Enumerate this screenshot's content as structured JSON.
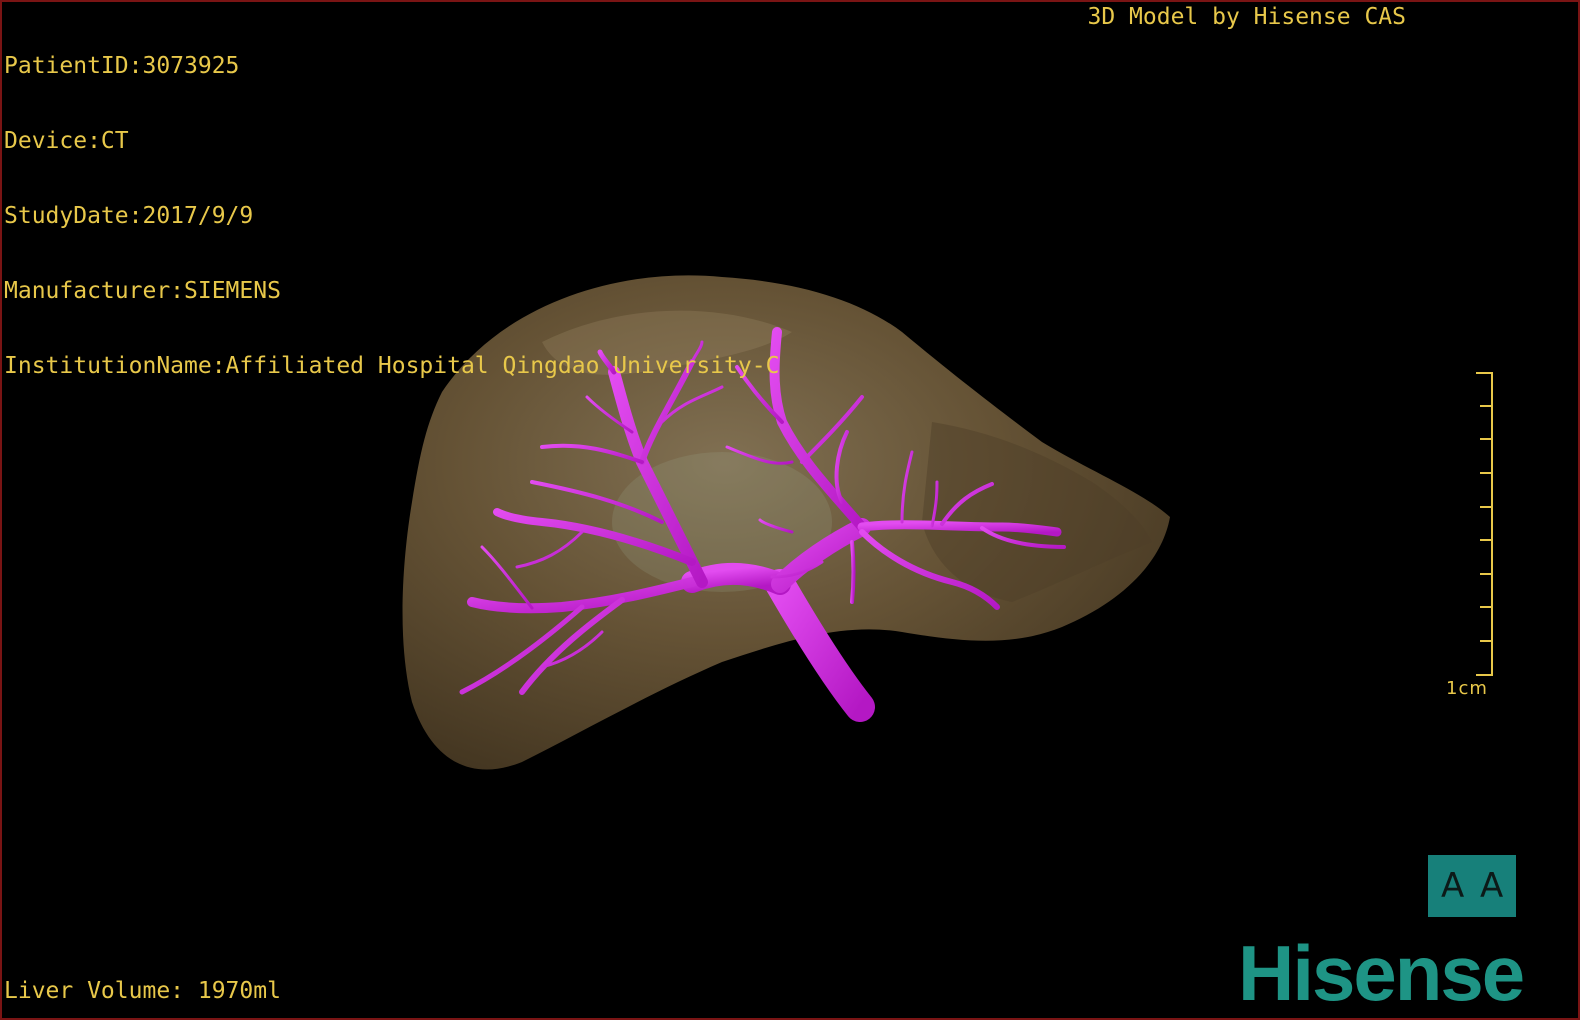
{
  "overlay": {
    "patient_id": "PatientID:3073925",
    "device": "Device:CT",
    "study_date": "StudyDate:2017/9/9",
    "manufacturer": "Manufacturer:SIEMENS",
    "institution": "InstitutionName:Affiliated Hospital Qingdao University-C",
    "credit": "3D Model by Hisense CAS",
    "liver_volume": "Liver Volume: 1970ml"
  },
  "scale": {
    "label": "1cm"
  },
  "orientation": {
    "left_glyph": "A",
    "right_glyph": "A"
  },
  "brand": {
    "logo_text": "Hisense"
  },
  "colors": {
    "overlay_text": "#e8c84a",
    "liver": "#6e5a3a",
    "vessel": "#d430e0",
    "brand": "#1e9485",
    "orientation_box": "#17807a",
    "frame": "#7a1414"
  }
}
